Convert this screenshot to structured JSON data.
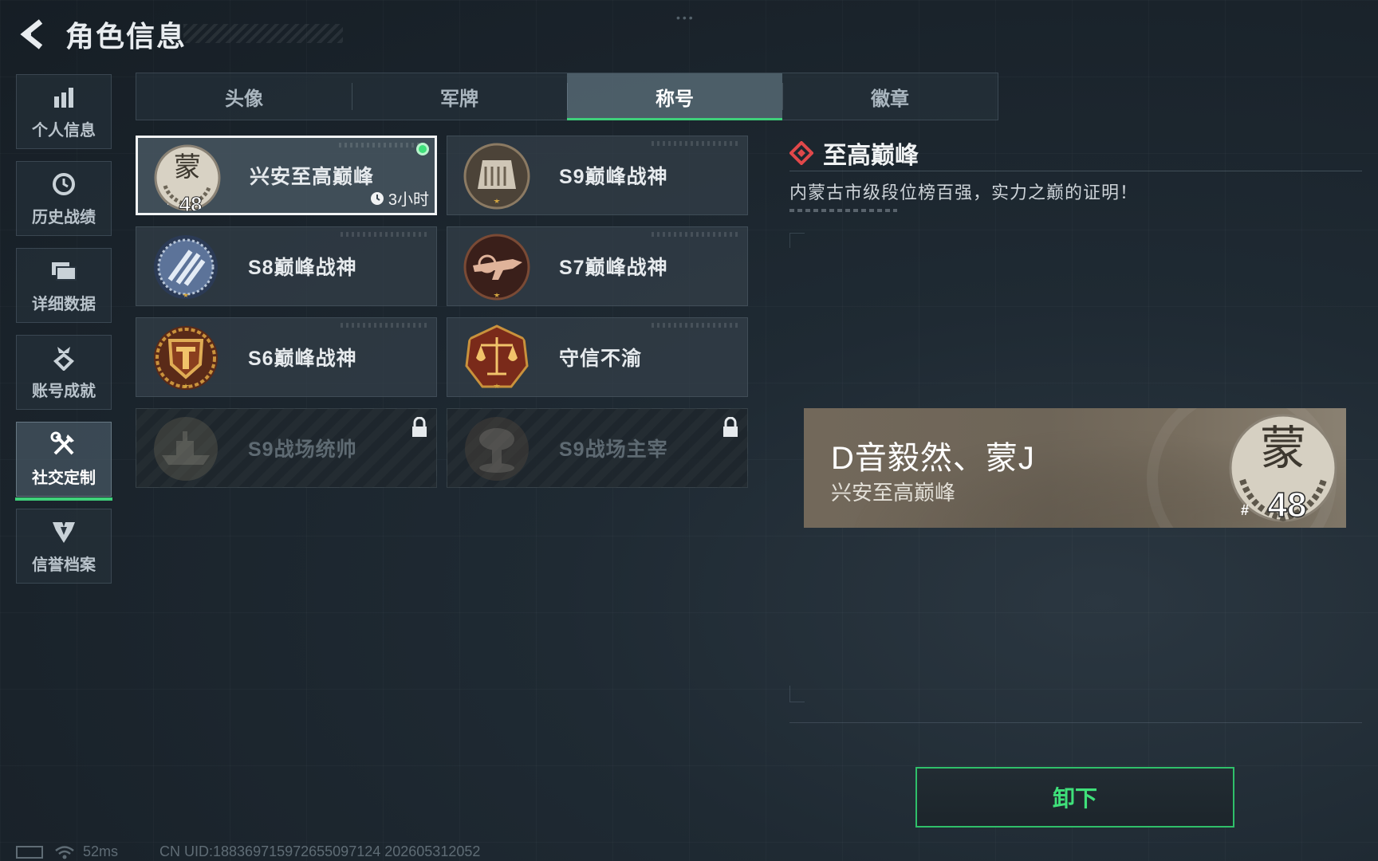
{
  "header": {
    "title": "角色信息"
  },
  "sidebar": {
    "items": [
      {
        "label": "个人信息",
        "icon": "bar-chart-icon",
        "active": false
      },
      {
        "label": "历史战绩",
        "icon": "clock-history-icon",
        "active": false
      },
      {
        "label": "详细数据",
        "icon": "folder-icon",
        "active": false
      },
      {
        "label": "账号成就",
        "icon": "medal-icon",
        "active": false
      },
      {
        "label": "社交定制",
        "icon": "tools-icon",
        "active": true
      },
      {
        "label": "信誉档案",
        "icon": "shield-wing-icon",
        "active": false
      }
    ]
  },
  "tabs": [
    {
      "label": "头像",
      "active": false
    },
    {
      "label": "军牌",
      "active": false
    },
    {
      "label": "称号",
      "active": true
    },
    {
      "label": "徽章",
      "active": false
    }
  ],
  "titles": [
    {
      "name": "兴安至高巅峰",
      "badge": "meng-48-badge",
      "selected": true,
      "equipped": true,
      "timer": "3小时",
      "badge_text": "#48"
    },
    {
      "name": "S9巅峰战神",
      "badge": "fortress-badge",
      "selected": false
    },
    {
      "name": "S8巅峰战神",
      "badge": "blue-stripes-badge",
      "selected": false
    },
    {
      "name": "S7巅峰战神",
      "badge": "rifle-badge",
      "selected": false
    },
    {
      "name": "S6巅峰战神",
      "badge": "gold-t-badge",
      "selected": false
    },
    {
      "name": "守信不渝",
      "badge": "scales-badge",
      "selected": false
    },
    {
      "name": "S9战场统帅",
      "badge": "warship-badge",
      "locked": true
    },
    {
      "name": "S9战场主宰",
      "badge": "mushroom-cloud-badge",
      "locked": true
    }
  ],
  "detail": {
    "name": "至高巅峰",
    "description": "内蒙古市级段位榜百强，实力之巅的证明！"
  },
  "nameplate": {
    "player_name": "D音毅然、蒙J",
    "title": "兴安至高巅峰",
    "badge_char": "蒙",
    "badge_rank": "48",
    "badge_hash": "#"
  },
  "actions": {
    "unequip_label": "卸下"
  },
  "status": {
    "ping": "52ms",
    "uid": "CN UID:188369715972655097124 202605312052"
  },
  "colors": {
    "accent_green": "#3fd07a",
    "diamond_red": "#e0484a"
  }
}
